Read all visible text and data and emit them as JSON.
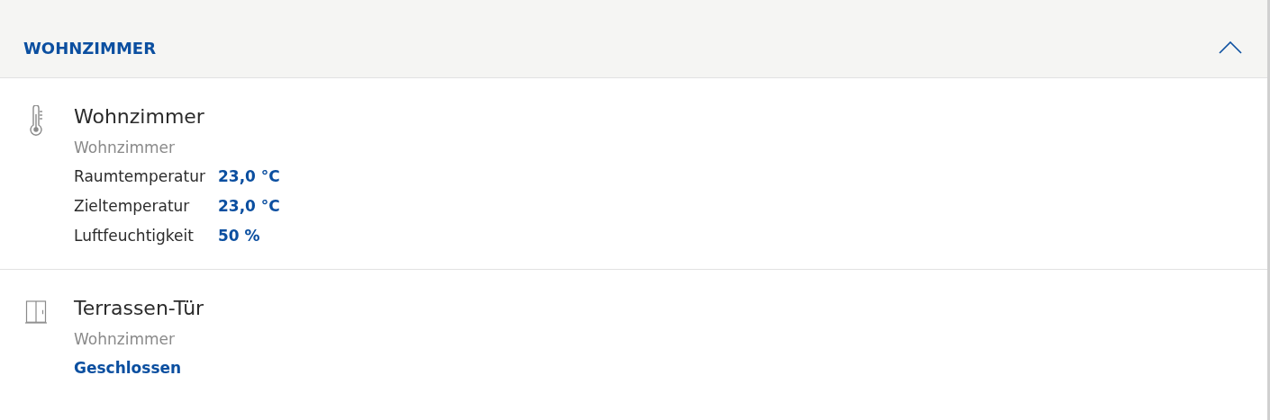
{
  "section": {
    "title": "WOHNZIMMER",
    "expanded": true
  },
  "devices": [
    {
      "kind": "thermostat",
      "name": "Wohnzimmer",
      "room": "Wohnzimmer",
      "readings": [
        {
          "label": "Raumtemperatur",
          "value": "23,0 °C"
        },
        {
          "label": "Zieltemperatur",
          "value": "23,0 °C"
        },
        {
          "label": "Luftfeuchtigkeit",
          "value": "50 %"
        }
      ]
    },
    {
      "kind": "door",
      "name": "Terrassen-Tür",
      "room": "Wohnzimmer",
      "status": "Geschlossen"
    }
  ]
}
